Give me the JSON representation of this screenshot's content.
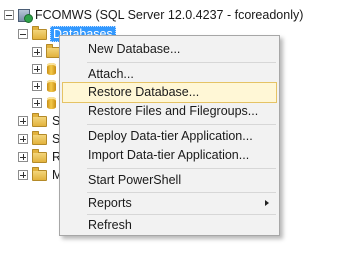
{
  "tree": {
    "server_label": "FCOMWS (SQL Server 12.0.4237 - fcoreadonly)",
    "databases_label": "Databases",
    "children": [
      "Se",
      "Se",
      "Re",
      "Ma"
    ]
  },
  "context_menu": {
    "new_database": "New Database...",
    "attach": "Attach...",
    "restore_database": "Restore Database...",
    "restore_files": "Restore Files and Filegroups...",
    "deploy_data_tier": "Deploy Data-tier Application...",
    "import_data_tier": "Import Data-tier Application...",
    "start_powershell": "Start PowerShell",
    "reports": "Reports",
    "refresh": "Refresh",
    "highlighted_item": "Restore Database..."
  },
  "colors": {
    "selection": "#3399ff",
    "menu_background": "#f2f2f2",
    "menu_highlight": "#fff7d6"
  }
}
